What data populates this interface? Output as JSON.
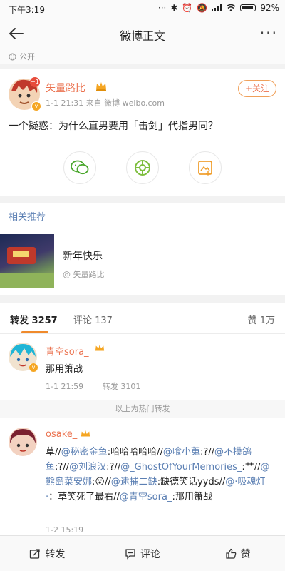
{
  "status_bar": {
    "time": "下午3:19",
    "battery": "92%"
  },
  "navbar": {
    "title": "微博正文",
    "more": "···"
  },
  "visibility": {
    "label": "公开"
  },
  "post": {
    "author": "矢量路比",
    "meta": "1-1 21:31  来自 微博 weibo.com",
    "follow_label": "+关注",
    "content": "一个疑惑：为什么直男要用「击剑」代指男同？",
    "share_buttons": [
      "wechat-icon",
      "moments-icon",
      "save-image-icon"
    ],
    "avatar_badge": "+1"
  },
  "recommendations": {
    "heading": "相关推荐",
    "items": [
      {
        "title": "新年快乐",
        "author": "@ 矢量路比"
      }
    ]
  },
  "tabs": {
    "repost": "转发 3257",
    "comment": "评论 137",
    "like": "赞 1万"
  },
  "repost_list": {
    "hot": [
      {
        "name": "青空sora_",
        "text": "那用箫战",
        "time": "1-1 21:59",
        "reposts": "转发 3101"
      }
    ],
    "hot_divider": "以上为热门转发",
    "latest": [
      {
        "name": "osake_",
        "segments": [
          {
            "t": "草//",
            "link": false
          },
          {
            "t": "@秘密金鱼",
            "link": true
          },
          {
            "t": ":哈哈哈哈哈//",
            "link": false
          },
          {
            "t": "@喰小蒐",
            "link": true
          },
          {
            "t": ":?//",
            "link": false
          },
          {
            "t": "@不摸鸽鱼",
            "link": true
          },
          {
            "t": ":?//",
            "link": false
          },
          {
            "t": "@刘浪汉",
            "link": true
          },
          {
            "t": ":?//",
            "link": false
          },
          {
            "t": "@_GhostOfYourMemories_",
            "link": true
          },
          {
            "t": ":艹//",
            "link": false
          },
          {
            "t": "@熊岛菜安娜",
            "link": true
          },
          {
            "t": ":😮//",
            "link": false
          },
          {
            "t": "@逮捕二缺",
            "link": true
          },
          {
            "t": ":缺德笑话yyds//",
            "link": false
          },
          {
            "t": "@·吸魂灯·",
            "link": true
          },
          {
            "t": "：草笑死了最右//",
            "link": false
          },
          {
            "t": "@青空sora_",
            "link": true
          },
          {
            "t": ":那用箫战",
            "link": false
          }
        ],
        "time": "1-2 15:19"
      }
    ]
  },
  "bottom_bar": {
    "repost": "转发",
    "comment": "评论",
    "like": "赞"
  },
  "colors": {
    "accent": "#eb7350",
    "link": "#5b7fb3",
    "tab_underline": "#f08a2b"
  }
}
